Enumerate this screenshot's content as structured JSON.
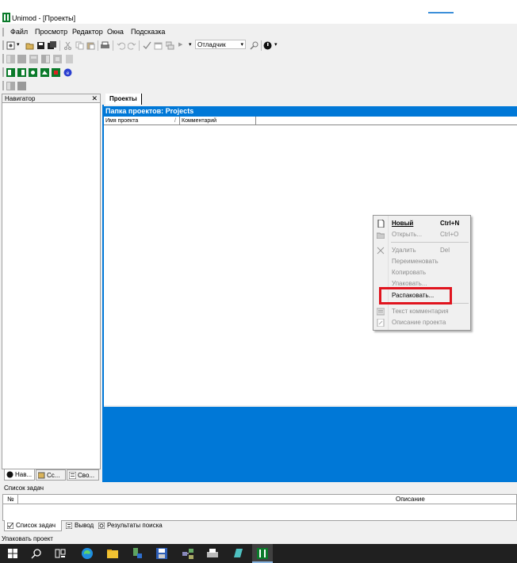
{
  "window": {
    "title": "Unimod - [Проекты]"
  },
  "menu": [
    "Файл",
    "Просмотр",
    "Редактор",
    "Окна",
    "Подсказка"
  ],
  "toolbar": {
    "config_combo": "Отладчик"
  },
  "navigator": {
    "title": "Навигатор",
    "close_glyph": "✕",
    "tabs": [
      "Нав...",
      "Сс...",
      "Сво..."
    ]
  },
  "projects": {
    "tab": "Проекты",
    "header": "Папка проектов: Projects",
    "columns": [
      "Имя проекта",
      "Комментарий"
    ],
    "sort_glyph": "/"
  },
  "context_menu": {
    "items": [
      {
        "label": "Новый",
        "shortcut": "Ctrl+N",
        "enabled": true,
        "bold": true,
        "icon": "new-doc-icon"
      },
      {
        "label": "Открыть...",
        "shortcut": "Ctrl+O",
        "enabled": false,
        "icon": "open-folder-icon"
      },
      {
        "label": "Удалить",
        "shortcut": "Del",
        "enabled": false,
        "icon": "delete-x-icon"
      },
      {
        "label": "Переименовать",
        "shortcut": "",
        "enabled": false
      },
      {
        "label": "Копировать",
        "shortcut": "",
        "enabled": false
      },
      {
        "label": "Упаковать...",
        "shortcut": "",
        "enabled": false
      },
      {
        "label": "Распаковать...",
        "shortcut": "",
        "enabled": true,
        "highlighted": true
      },
      {
        "label": "Текст комментария",
        "shortcut": "",
        "enabled": false,
        "icon": "comment-icon"
      },
      {
        "label": "Описание проекта",
        "shortcut": "",
        "enabled": false,
        "icon": "description-icon"
      }
    ]
  },
  "tasks": {
    "title": "Список задач",
    "columns": [
      "№",
      "Описание"
    ],
    "tabs": [
      "Список задач",
      "Вывод",
      "Результаты поиска"
    ]
  },
  "status": {
    "text": "Упаковать проект"
  },
  "colors": {
    "accent": "#0078d7",
    "highlight_border": "#e0141e",
    "taskbar": "#202020"
  }
}
